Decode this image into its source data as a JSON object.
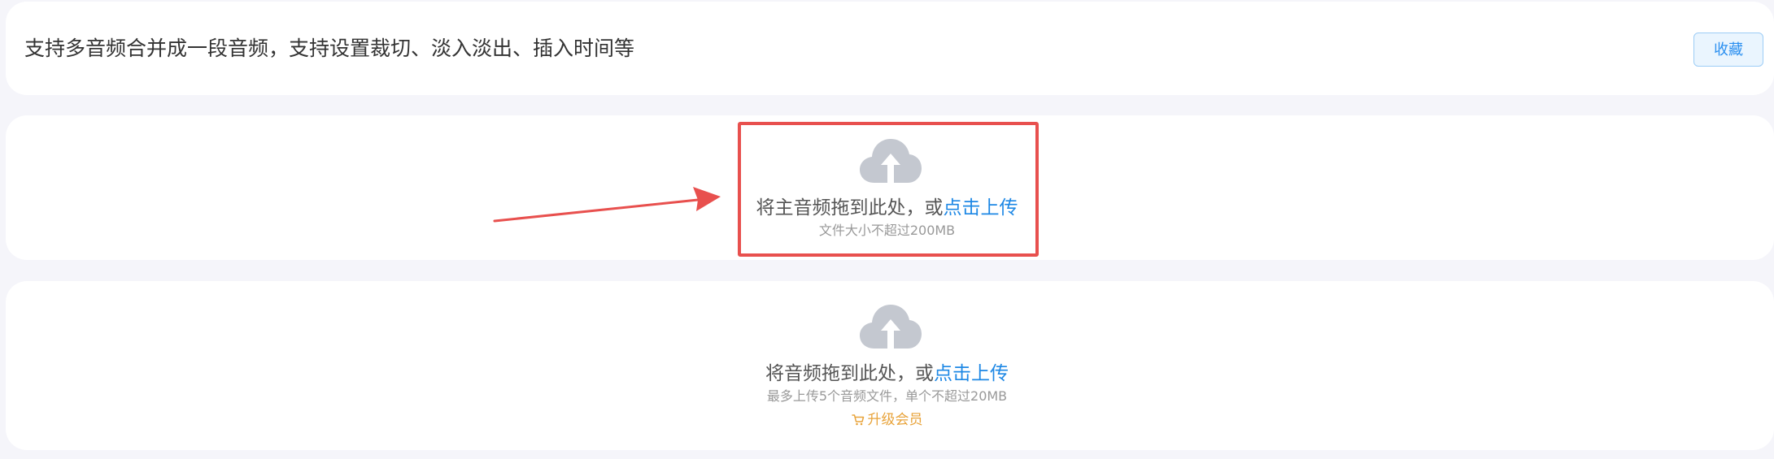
{
  "header": {
    "title": "支持多音频合并成一段音频，支持设置裁切、淡入淡出、插入时间等",
    "favorite_label": "收藏"
  },
  "main_upload": {
    "drop_text": "将主音频拖到此处，或",
    "upload_link": "点击上传",
    "size_limit": "文件大小不超过200MB",
    "icon": "cloud-upload-icon"
  },
  "audio_upload": {
    "drop_text": "将音频拖到此处，或",
    "upload_link": "点击上传",
    "limit_hint": "最多上传5个音频文件，单个不超过20MB",
    "upgrade_label": "升级会员",
    "icon": "cloud-upload-icon",
    "upgrade_icon": "cart-icon"
  },
  "colors": {
    "accent": "#1e88e5",
    "highlight": "#e8504e",
    "upgrade": "#e8a33a",
    "cloud": "#c4c8d0"
  }
}
